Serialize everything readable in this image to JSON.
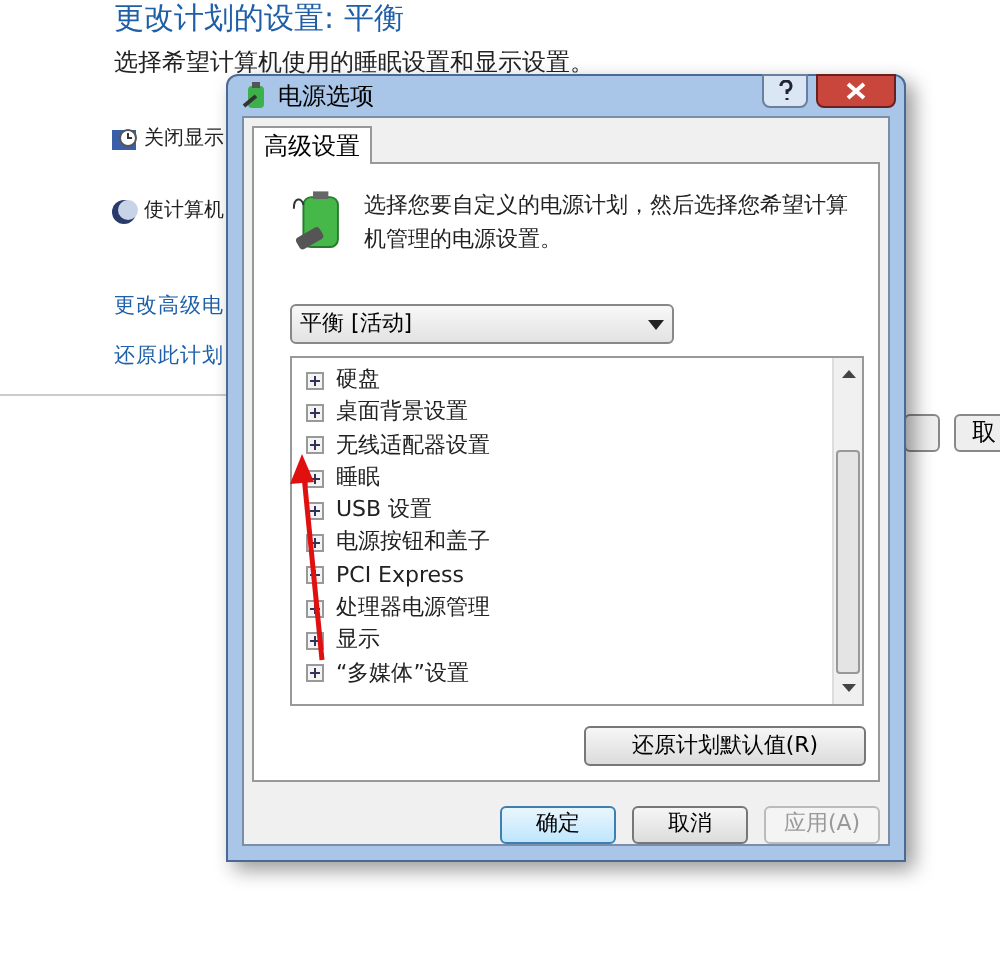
{
  "background_page": {
    "title": "更改计划的设置: 平衡",
    "subtitle": "选择希望计算机使用的睡眠设置和显示设置。",
    "options": [
      {
        "label": "关闭显示",
        "kind": "monitor"
      },
      {
        "label": "使计算机",
        "kind": "moon"
      }
    ],
    "links": [
      "更改高级电",
      "还原此计划"
    ],
    "buttons": [
      "取"
    ]
  },
  "window": {
    "title": "电源选项"
  },
  "tabs": [
    {
      "label": "高级设置",
      "selected": true
    }
  ],
  "description": "选择您要自定义的电源计划，然后选择您希望计算机管理的电源设置。",
  "plan_dropdown": {
    "value": "平衡 [活动]"
  },
  "settings_tree": [
    {
      "label": "硬盘",
      "expanded": false
    },
    {
      "label": "桌面背景设置",
      "expanded": false
    },
    {
      "label": "无线适配器设置",
      "expanded": false
    },
    {
      "label": "睡眠",
      "expanded": false
    },
    {
      "label": "USB 设置",
      "expanded": false
    },
    {
      "label": "电源按钮和盖子",
      "expanded": false
    },
    {
      "label": "PCI Express",
      "expanded": false
    },
    {
      "label": "处理器电源管理",
      "expanded": false
    },
    {
      "label": "显示",
      "expanded": false
    },
    {
      "label": "“多媒体”设置",
      "expanded": false
    }
  ],
  "restore_button": "还原计划默认值(R)",
  "buttons": [
    {
      "label": "确定",
      "disabled": false
    },
    {
      "label": "取消",
      "disabled": false
    },
    {
      "label": "应用(A)",
      "disabled": true
    }
  ]
}
